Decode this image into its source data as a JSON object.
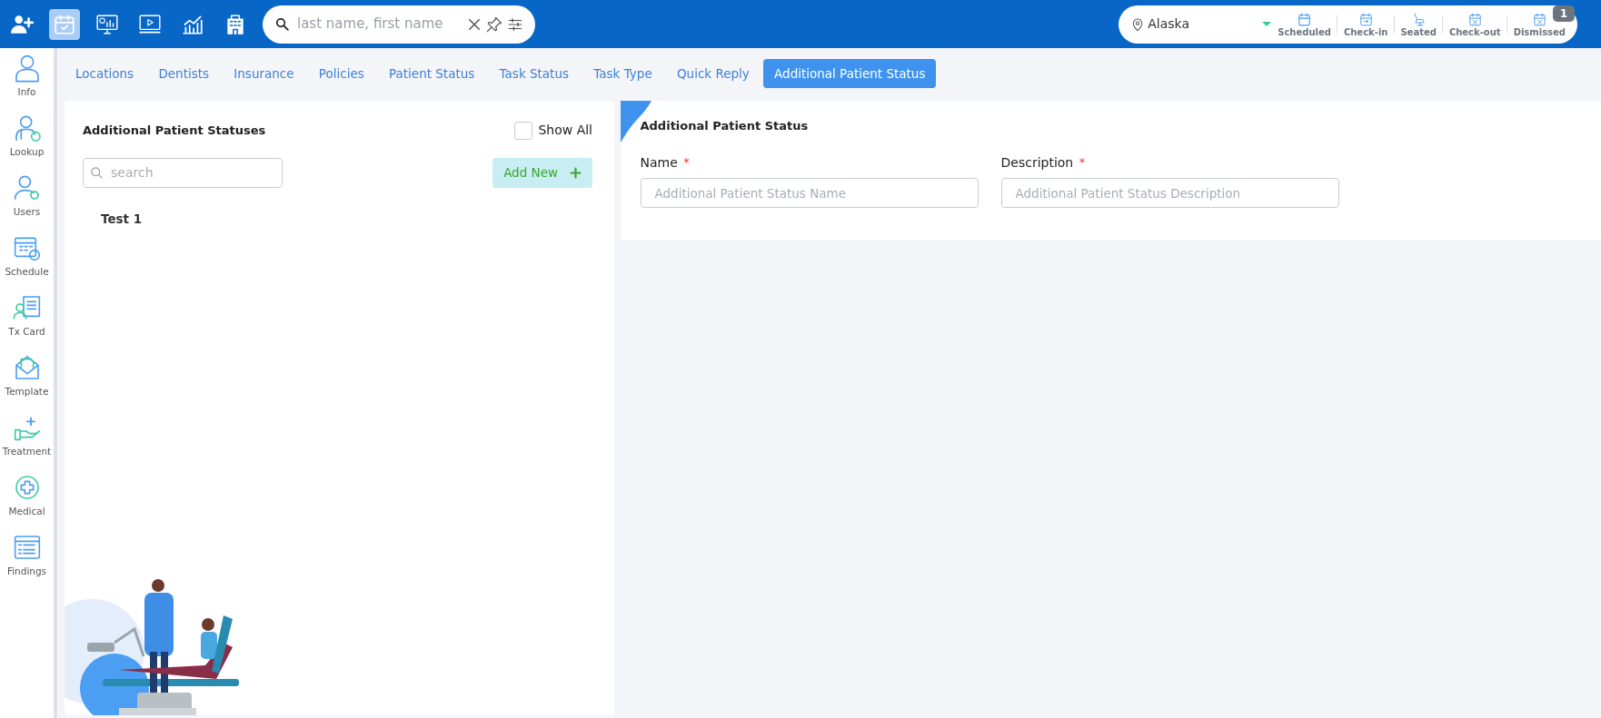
{
  "toolbar_buttons": [
    {
      "kind": "add-user",
      "selected": false
    },
    {
      "kind": "calendar",
      "selected": true
    },
    {
      "kind": "dashboard",
      "selected": false
    },
    {
      "kind": "video",
      "selected": false
    },
    {
      "kind": "chart",
      "selected": false
    },
    {
      "kind": "building",
      "selected": false
    }
  ],
  "patient_search": {
    "placeholder": "last name, first name"
  },
  "location": {
    "value": "Alaska"
  },
  "statuses": [
    {
      "label": "Scheduled",
      "kind": "calendar"
    },
    {
      "label": "Check-in",
      "kind": "checkin"
    },
    {
      "label": "Seated",
      "kind": "chair"
    },
    {
      "label": "Check-out",
      "kind": "cross"
    },
    {
      "label": "Dismissed",
      "kind": "cross",
      "badge": "1"
    }
  ],
  "sidebar": {
    "items": [
      {
        "label": "Info",
        "kind": "person"
      },
      {
        "label": "Lookup",
        "kind": "doctor"
      },
      {
        "label": "Users",
        "kind": "user-gear"
      },
      {
        "label": "Schedule",
        "kind": "schedule"
      },
      {
        "label": "Tx Card",
        "kind": "card"
      },
      {
        "label": "Template",
        "kind": "envelope"
      },
      {
        "label": "Treatment",
        "kind": "hand"
      },
      {
        "label": "Medical",
        "kind": "medical"
      },
      {
        "label": "Findings",
        "kind": "findings"
      }
    ]
  },
  "tabs": [
    {
      "label": "Locations",
      "selected": false
    },
    {
      "label": "Dentists",
      "selected": false
    },
    {
      "label": "Insurance",
      "selected": false
    },
    {
      "label": "Policies",
      "selected": false
    },
    {
      "label": "Patient Status",
      "selected": false
    },
    {
      "label": "Task Status",
      "selected": false
    },
    {
      "label": "Task Type",
      "selected": false
    },
    {
      "label": "Quick Reply",
      "selected": false
    },
    {
      "label": "Additional Patient Status",
      "selected": true
    }
  ],
  "list_panel": {
    "title": "Additional Patient Statuses",
    "show_all": {
      "label": "Show All",
      "checked": false
    },
    "search": {
      "placeholder": "search"
    },
    "add_button": "Add New",
    "items": [
      {
        "label": "Test 1"
      }
    ]
  },
  "form": {
    "title": "Additional Patient Status",
    "fields": [
      {
        "label": "Name",
        "required_mark": "*",
        "placeholder": "Additional Patient Status Name"
      },
      {
        "label": "Description",
        "required_mark": "*",
        "placeholder": "Additional Patient Status Description"
      }
    ]
  }
}
